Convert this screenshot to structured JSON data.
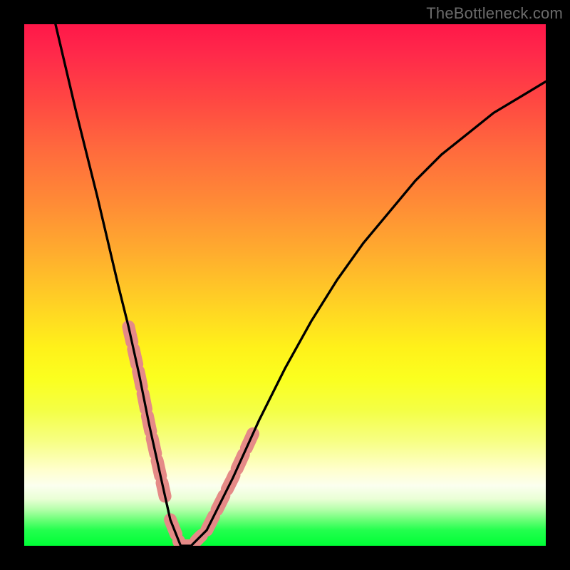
{
  "watermark": "TheBottleneck.com",
  "gradient_stops": [
    {
      "pct": 0,
      "color": "#ff1749"
    },
    {
      "pct": 14,
      "color": "#ff4543"
    },
    {
      "pct": 34,
      "color": "#ff8a36"
    },
    {
      "pct": 54,
      "color": "#ffd324"
    },
    {
      "pct": 74,
      "color": "#f4ff45"
    },
    {
      "pct": 86,
      "color": "#ffffce"
    },
    {
      "pct": 93,
      "color": "#b6ffab"
    },
    {
      "pct": 100,
      "color": "#00ff36"
    }
  ],
  "chart_data": {
    "type": "line",
    "title": "",
    "xlabel": "",
    "ylabel": "",
    "xlim": [
      0,
      100
    ],
    "ylim": [
      0,
      100
    ],
    "grid": false,
    "series": [
      {
        "name": "bottleneck-curve",
        "x": [
          6,
          10,
          14,
          18,
          20,
          22,
          24,
          26,
          28,
          30,
          32,
          35,
          40,
          45,
          50,
          55,
          60,
          65,
          70,
          75,
          80,
          85,
          90,
          95,
          100
        ],
        "y": [
          100,
          83,
          67,
          50,
          42,
          33,
          23,
          14,
          5,
          0,
          0,
          3,
          13,
          24,
          34,
          43,
          51,
          58,
          64,
          70,
          75,
          79,
          83,
          86,
          89
        ]
      }
    ],
    "highlighted_segments": [
      {
        "name": "left-beads",
        "x_range": [
          20,
          27
        ],
        "y_range": [
          8,
          42
        ]
      },
      {
        "name": "valley-beads",
        "x_range": [
          28,
          34
        ],
        "y_range": [
          0,
          4
        ]
      },
      {
        "name": "right-beads",
        "x_range": [
          35,
          44
        ],
        "y_range": [
          3,
          24
        ]
      }
    ],
    "notes": "V-shaped bottleneck curve over a vertical red→yellow→green gradient. Salmon bead markers sit along the curve near the valley on both arms and across the minimum. No axis ticks or numeric labels are rendered."
  }
}
